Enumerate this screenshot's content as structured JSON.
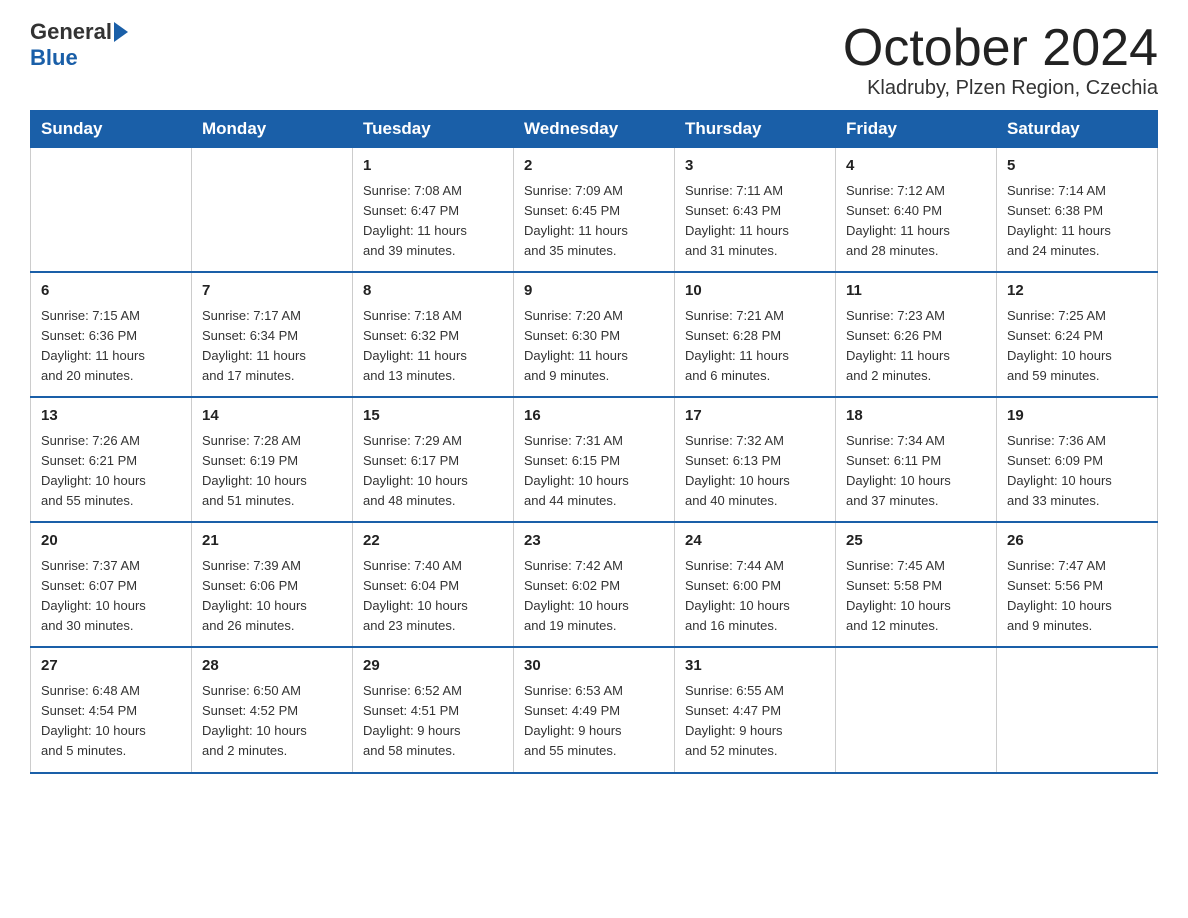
{
  "logo": {
    "line1": "General",
    "line2": "Blue"
  },
  "title": "October 2024",
  "subtitle": "Kladruby, Plzen Region, Czechia",
  "headers": [
    "Sunday",
    "Monday",
    "Tuesday",
    "Wednesday",
    "Thursday",
    "Friday",
    "Saturday"
  ],
  "weeks": [
    [
      {
        "day": "",
        "info": ""
      },
      {
        "day": "",
        "info": ""
      },
      {
        "day": "1",
        "info": "Sunrise: 7:08 AM\nSunset: 6:47 PM\nDaylight: 11 hours\nand 39 minutes."
      },
      {
        "day": "2",
        "info": "Sunrise: 7:09 AM\nSunset: 6:45 PM\nDaylight: 11 hours\nand 35 minutes."
      },
      {
        "day": "3",
        "info": "Sunrise: 7:11 AM\nSunset: 6:43 PM\nDaylight: 11 hours\nand 31 minutes."
      },
      {
        "day": "4",
        "info": "Sunrise: 7:12 AM\nSunset: 6:40 PM\nDaylight: 11 hours\nand 28 minutes."
      },
      {
        "day": "5",
        "info": "Sunrise: 7:14 AM\nSunset: 6:38 PM\nDaylight: 11 hours\nand 24 minutes."
      }
    ],
    [
      {
        "day": "6",
        "info": "Sunrise: 7:15 AM\nSunset: 6:36 PM\nDaylight: 11 hours\nand 20 minutes."
      },
      {
        "day": "7",
        "info": "Sunrise: 7:17 AM\nSunset: 6:34 PM\nDaylight: 11 hours\nand 17 minutes."
      },
      {
        "day": "8",
        "info": "Sunrise: 7:18 AM\nSunset: 6:32 PM\nDaylight: 11 hours\nand 13 minutes."
      },
      {
        "day": "9",
        "info": "Sunrise: 7:20 AM\nSunset: 6:30 PM\nDaylight: 11 hours\nand 9 minutes."
      },
      {
        "day": "10",
        "info": "Sunrise: 7:21 AM\nSunset: 6:28 PM\nDaylight: 11 hours\nand 6 minutes."
      },
      {
        "day": "11",
        "info": "Sunrise: 7:23 AM\nSunset: 6:26 PM\nDaylight: 11 hours\nand 2 minutes."
      },
      {
        "day": "12",
        "info": "Sunrise: 7:25 AM\nSunset: 6:24 PM\nDaylight: 10 hours\nand 59 minutes."
      }
    ],
    [
      {
        "day": "13",
        "info": "Sunrise: 7:26 AM\nSunset: 6:21 PM\nDaylight: 10 hours\nand 55 minutes."
      },
      {
        "day": "14",
        "info": "Sunrise: 7:28 AM\nSunset: 6:19 PM\nDaylight: 10 hours\nand 51 minutes."
      },
      {
        "day": "15",
        "info": "Sunrise: 7:29 AM\nSunset: 6:17 PM\nDaylight: 10 hours\nand 48 minutes."
      },
      {
        "day": "16",
        "info": "Sunrise: 7:31 AM\nSunset: 6:15 PM\nDaylight: 10 hours\nand 44 minutes."
      },
      {
        "day": "17",
        "info": "Sunrise: 7:32 AM\nSunset: 6:13 PM\nDaylight: 10 hours\nand 40 minutes."
      },
      {
        "day": "18",
        "info": "Sunrise: 7:34 AM\nSunset: 6:11 PM\nDaylight: 10 hours\nand 37 minutes."
      },
      {
        "day": "19",
        "info": "Sunrise: 7:36 AM\nSunset: 6:09 PM\nDaylight: 10 hours\nand 33 minutes."
      }
    ],
    [
      {
        "day": "20",
        "info": "Sunrise: 7:37 AM\nSunset: 6:07 PM\nDaylight: 10 hours\nand 30 minutes."
      },
      {
        "day": "21",
        "info": "Sunrise: 7:39 AM\nSunset: 6:06 PM\nDaylight: 10 hours\nand 26 minutes."
      },
      {
        "day": "22",
        "info": "Sunrise: 7:40 AM\nSunset: 6:04 PM\nDaylight: 10 hours\nand 23 minutes."
      },
      {
        "day": "23",
        "info": "Sunrise: 7:42 AM\nSunset: 6:02 PM\nDaylight: 10 hours\nand 19 minutes."
      },
      {
        "day": "24",
        "info": "Sunrise: 7:44 AM\nSunset: 6:00 PM\nDaylight: 10 hours\nand 16 minutes."
      },
      {
        "day": "25",
        "info": "Sunrise: 7:45 AM\nSunset: 5:58 PM\nDaylight: 10 hours\nand 12 minutes."
      },
      {
        "day": "26",
        "info": "Sunrise: 7:47 AM\nSunset: 5:56 PM\nDaylight: 10 hours\nand 9 minutes."
      }
    ],
    [
      {
        "day": "27",
        "info": "Sunrise: 6:48 AM\nSunset: 4:54 PM\nDaylight: 10 hours\nand 5 minutes."
      },
      {
        "day": "28",
        "info": "Sunrise: 6:50 AM\nSunset: 4:52 PM\nDaylight: 10 hours\nand 2 minutes."
      },
      {
        "day": "29",
        "info": "Sunrise: 6:52 AM\nSunset: 4:51 PM\nDaylight: 9 hours\nand 58 minutes."
      },
      {
        "day": "30",
        "info": "Sunrise: 6:53 AM\nSunset: 4:49 PM\nDaylight: 9 hours\nand 55 minutes."
      },
      {
        "day": "31",
        "info": "Sunrise: 6:55 AM\nSunset: 4:47 PM\nDaylight: 9 hours\nand 52 minutes."
      },
      {
        "day": "",
        "info": ""
      },
      {
        "day": "",
        "info": ""
      }
    ]
  ]
}
